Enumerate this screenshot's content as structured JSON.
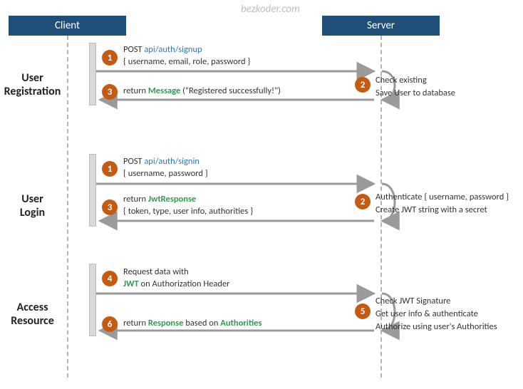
{
  "watermark": "bezkoder.com",
  "headers": {
    "client": "Client",
    "server": "Server"
  },
  "sections": {
    "registration": "User\nRegistration",
    "login": "User\nLogin",
    "access": "Access\nResource"
  },
  "reg": {
    "step1_method": "POST ",
    "step1_api": "api/auth/signup",
    "step1_body": "{ username, email, role, password }",
    "step2_l1": "Check existing",
    "step2_l2_pre": "Save ",
    "step2_l2_kw": "User",
    "step2_l2_post": " to database",
    "step3_pre": "return ",
    "step3_kw": "Message",
    "step3_post": " (\"Registered successfully!\")"
  },
  "login": {
    "step1_method": "POST ",
    "step1_api": "api/auth/signin",
    "step1_body": "{ username, password }",
    "step2_l1": "Authenticate { username, password }",
    "step2_l2_pre": "Create ",
    "step2_l2_kw": "JWT",
    "step2_l2_post": " string with a secret",
    "step3_pre": "return ",
    "step3_kw": "JwtResponse",
    "step3_body": "{ token, type, user info, authorities }"
  },
  "access": {
    "step4_l1": "Request  data with",
    "step4_kw": "JWT",
    "step4_post": " on Authorization Header",
    "step5_l1_pre": "Check ",
    "step5_l1_kw": "JWT",
    "step5_l1_post": " Signature",
    "step5_l2": "Get user info & authenticate",
    "step5_l3": "Authorize using user's Authorities",
    "step6_pre": "return ",
    "step6_kw": "Response",
    "step6_mid": " based on ",
    "step6_kw2": "Authorities"
  },
  "nums": {
    "n1": "1",
    "n2": "2",
    "n3": "3",
    "n4": "4",
    "n5": "5",
    "n6": "6"
  }
}
